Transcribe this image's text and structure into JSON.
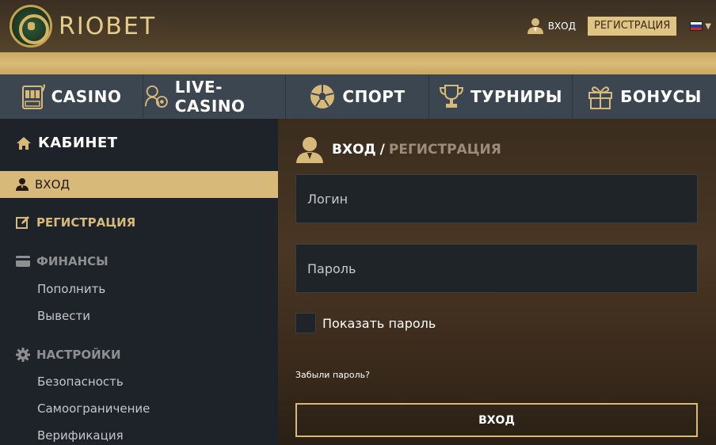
{
  "header": {
    "logo_text": "RIOBET",
    "login_label": "ВХОД",
    "register_label": "РЕГИСТРАЦИЯ",
    "language": "ru",
    "accent_color": "#d7b97a"
  },
  "nav": {
    "items": [
      {
        "label": "CASINO",
        "icon": "slot-machine-icon"
      },
      {
        "label": "LIVE-CASINO",
        "icon": "dealer-icon"
      },
      {
        "label": "СПОРТ",
        "icon": "soccer-ball-icon"
      },
      {
        "label": "ТУРНИРЫ",
        "icon": "trophy-icon"
      },
      {
        "label": "БОНУСЫ",
        "icon": "gift-icon"
      }
    ]
  },
  "sidebar": {
    "title": "КАБИНЕТ",
    "active_item": "ВХОД",
    "register_item": "РЕГИСТРАЦИЯ",
    "finance_section": "ФИНАНСЫ",
    "finance_items": [
      "Пополнить",
      "Вывести"
    ],
    "settings_section": "НАСТРОЙКИ",
    "settings_items": [
      "Безопасность",
      "Самоограничение",
      "Верификация"
    ]
  },
  "form": {
    "title_login": "ВХОД",
    "title_sep": "/",
    "title_register": "РЕГИСТРАЦИЯ",
    "login_placeholder": "Логин",
    "password_placeholder": "Пароль",
    "show_password_label": "Показать пароль",
    "forgot_label": "Забыли пароль?",
    "submit_label": "ВХОД"
  }
}
